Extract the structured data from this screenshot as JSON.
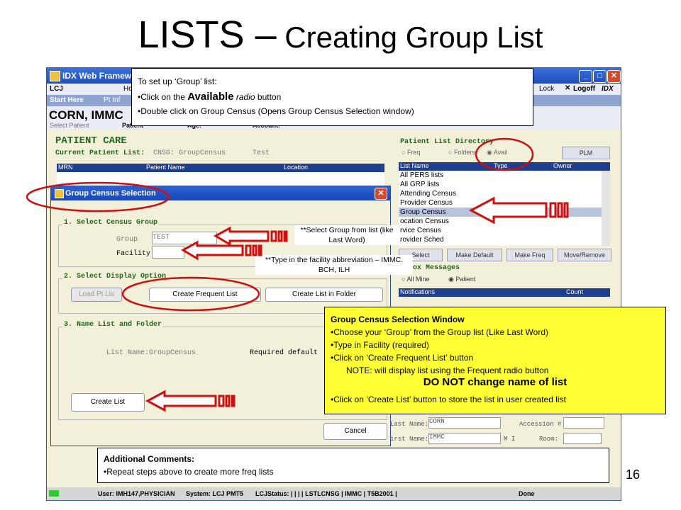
{
  "slide": {
    "title_big": "LISTS –",
    "title_small": " Creating Group List",
    "page_number": "16"
  },
  "app": {
    "window_title": "IDX Web Framework",
    "menu": {
      "left": "LCJ",
      "item2": "Ho",
      "lock": "Lock",
      "logoff": "Logoff",
      "brand": "IDX"
    },
    "toolbar": {
      "start_here": "Start Here",
      "item2": "Pt Inf"
    },
    "patient_name": "CORN, IMMC",
    "patient_row": {
      "select_patient": "Select Patient",
      "patient_label": "Patient",
      "age_label": "Age:",
      "account_label": "Account:"
    },
    "patient_care": "PATIENT CARE",
    "current_list": {
      "label": "Current Patient List:",
      "value": "CNSG: GroupCensus",
      "extra": "Test"
    },
    "left_table_headers": [
      "MRN",
      "Patient Name",
      "Location"
    ],
    "directory": {
      "title": "Patient List Directory",
      "radios": [
        "Freq",
        "Folders",
        "Avail"
      ],
      "plm_button": "PLM",
      "headers": [
        "List Name",
        "Type",
        "Owner"
      ],
      "items": [
        "All PERS lists",
        "All GRP lists",
        "Attending Census",
        "Provider Census",
        "Group Census",
        "ocation Census",
        "rvice Census",
        "rovider Sched"
      ],
      "selected_index": 4,
      "buttons": [
        "Select",
        "Make Default",
        "Make Freq",
        "Move/Remove"
      ]
    },
    "inbox": {
      "title": "Inbox Messages",
      "radios": [
        "All Mine",
        "Patient"
      ],
      "headers": [
        "Notifications",
        "Count"
      ]
    },
    "form": {
      "last_name_label": "Last Name:",
      "last_name_value": "CORN",
      "accession_label": "Accession #",
      "first_name_label": "irst Name:",
      "first_name_value": "IMMC",
      "mi_label": "M I",
      "room_label": "Room:"
    },
    "status": {
      "user": "User: IMH147,PHYSICIAN",
      "system": "System: LCJ PMT5",
      "lcj_status": "LCJStatus: | | | | LSTLCNSG | IMMC | T5B2001 |",
      "done": "Done"
    }
  },
  "dialog": {
    "title": "Group Census Selection",
    "section1": "1. Select Census Group",
    "group_label": "Group",
    "group_value": "TEST",
    "facility_label": "Facility:",
    "section2": "2. Select Display Option",
    "load_button": "Load Pt Lis",
    "create_frequent_button": "Create Frequent List",
    "create_folder_button": "Create List in Folder",
    "section3": "3. Name List and Folder",
    "list_name": "List Name:GroupCensus",
    "required": "Required default",
    "create_list_button": "Create List",
    "cancel_button": "Cancel"
  },
  "callouts": {
    "setup": {
      "line1": "To set up ‘Group’ list:",
      "line2_pre": "•Click on the ",
      "line2_bold": "Available",
      "line2_italic": " radio",
      "line2_post": " button",
      "line3": "•Double click on Group Census (Opens Group Census Selection window)"
    },
    "select_group": "**Select Group from list (like Last Word)",
    "type_facility": "**Type in the facility abbreviation – IMMC. BCH, ILH",
    "window_box": {
      "title": "Group Census Selection Window",
      "b1": "•Choose your ‘Group’ from the Group list (Like Last Word)",
      "b2": "•Type in Facility (required)",
      "b3": "•Click on ‘Create Frequent List’ button",
      "note": "NOTE: will display list using the Frequent radio button",
      "warning": "DO NOT change name of list",
      "b4": "•Click on ‘Create List’ button to store the list in user created list"
    },
    "additional": {
      "title": "Additional Comments:",
      "line": "•Repeat steps above to create more freq lists"
    }
  },
  "colors": {
    "arrow": "#cc1111",
    "callout_yellow": "#ffff33",
    "title_blue": "#1f4fbf"
  }
}
